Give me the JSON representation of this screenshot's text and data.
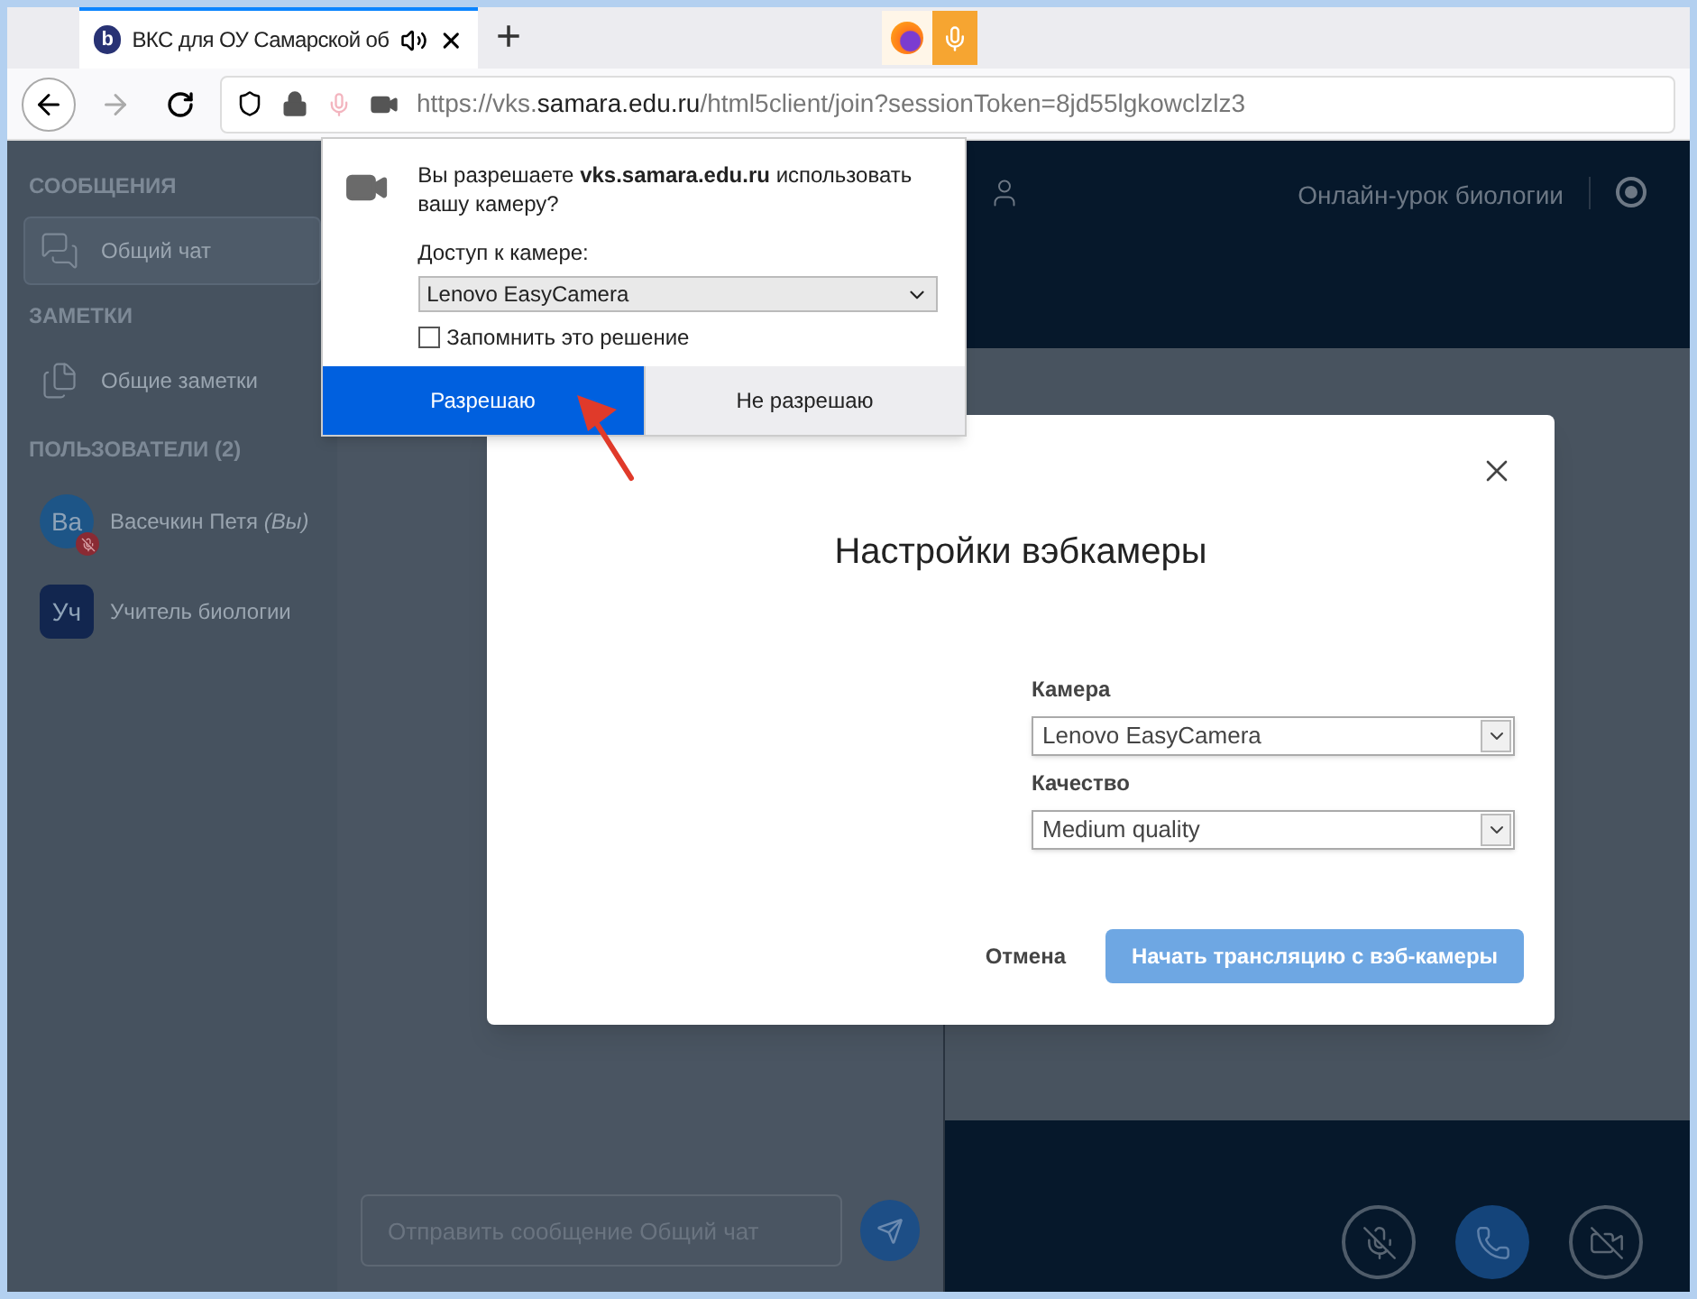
{
  "browser": {
    "tab": {
      "favicon": "b",
      "title": "ВКС для ОУ Самарской об"
    },
    "new_tab": "+",
    "url_parts": [
      {
        "text": "https://vks.",
        "emphasis": false
      },
      {
        "text": "samara.edu.ru",
        "emphasis": true
      },
      {
        "text": "/html5client/join?sessionToken=8jd55lgkowclzlz3",
        "emphasis": false
      }
    ]
  },
  "permission_popup": {
    "question": "Вы разрешаете **vks.samara.edu.ru** использовать вашу камеру?",
    "select_label": "Доступ к камере:",
    "select_value": "Lenovo EasyCamera",
    "remember": {
      "label": "Запомнить это решение",
      "checked": false
    },
    "buttons": [
      {
        "label": "Разрешаю",
        "kind": "primary"
      },
      {
        "label": "Не разрешаю",
        "kind": "secondary"
      }
    ]
  },
  "sidebar": {
    "sections": [
      {
        "title": "СООБЩЕНИЯ",
        "items": [
          {
            "label": "Общий чат",
            "kind": "chat",
            "selected": true
          }
        ]
      },
      {
        "title": "ЗАМЕТКИ",
        "items": [
          {
            "label": "Общие заметки",
            "kind": "notes",
            "selected": false
          }
        ]
      }
    ],
    "users_title": "ПОЛЬЗОВАТЕЛИ (2)",
    "users": [
      {
        "initials": "Ва",
        "name": "Васечкин Петя",
        "suffix": "(Вы)",
        "kind": "viewer",
        "muted": true
      },
      {
        "initials": "Уч",
        "name": "Учитель биологии",
        "kind": "presenter",
        "muted": false
      }
    ]
  },
  "chat": {
    "placeholder": "Отправить сообщение Общий чат"
  },
  "header": {
    "meeting_title": "Онлайн-урок биологии"
  },
  "dialog": {
    "title": "Настройки вэбкамеры",
    "fields": [
      {
        "label": "Камера",
        "value": "Lenovo EasyCamera"
      },
      {
        "label": "Качество",
        "value": "Medium quality"
      }
    ],
    "cancel": "Отмена",
    "confirm": "Начать трансляцию с вэб-камеры"
  },
  "controls": [
    {
      "kind": "mic",
      "active": false
    },
    {
      "kind": "phone",
      "active": true
    },
    {
      "kind": "camera",
      "active": false
    }
  ]
}
